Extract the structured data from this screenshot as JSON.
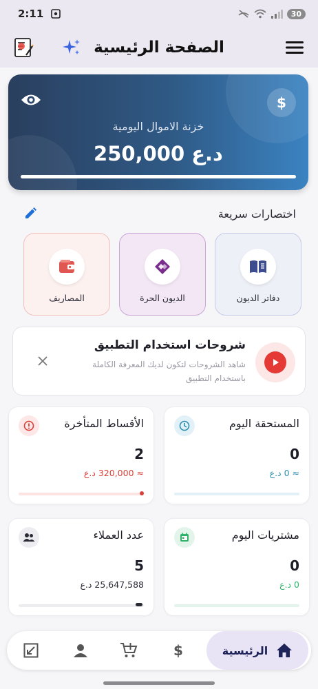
{
  "status": {
    "time": "2:11",
    "battery": "30"
  },
  "appbar": {
    "title": "الصفحة الرئيسية"
  },
  "balance_card": {
    "title": "خزنة الاموال اليومية",
    "amount": "250,000 د.ع",
    "progress": 1.0
  },
  "quick": {
    "title": "اختصارات سريعة",
    "items": [
      {
        "label": "دفاتر الديون",
        "icon": "book-icon",
        "color": "#3d4b8f"
      },
      {
        "label": "الديون الحرة",
        "icon": "handshake-icon",
        "color": "#7b2d8e"
      },
      {
        "label": "المصاريف",
        "icon": "wallet-icon",
        "color": "#e05650"
      }
    ]
  },
  "tutorial": {
    "title": "شروحات استخدام التطبيق",
    "description": "شاهد الشروحات لتكون لديك المعرفة الكاملة باستخدام التطبيق"
  },
  "stats": {
    "due_today": {
      "title": "المستحقة اليوم",
      "count": "0",
      "amount": "≈ 0 د.ع",
      "color": "#2e8fb0",
      "progress": 0
    },
    "late_installments": {
      "title": "الأقساط المتأخرة",
      "count": "2",
      "amount": "≈ 320,000 د.ع",
      "color": "#d9403a",
      "progress": 0.02
    },
    "purchases_today": {
      "title": "مشتريات اليوم",
      "count": "0",
      "amount": "0 د.ع",
      "color": "#2fb36b",
      "progress": 0
    },
    "clients_count": {
      "title": "عدد العملاء",
      "count": "5",
      "amount": "25,647,588 د.ع",
      "color": "#2a2a35",
      "progress": 0.04
    }
  },
  "bottom_nav": {
    "home_label": "الرئيسية",
    "items": [
      "home-icon",
      "dollar-icon",
      "cart-add-icon",
      "person-icon",
      "expand-icon"
    ]
  }
}
